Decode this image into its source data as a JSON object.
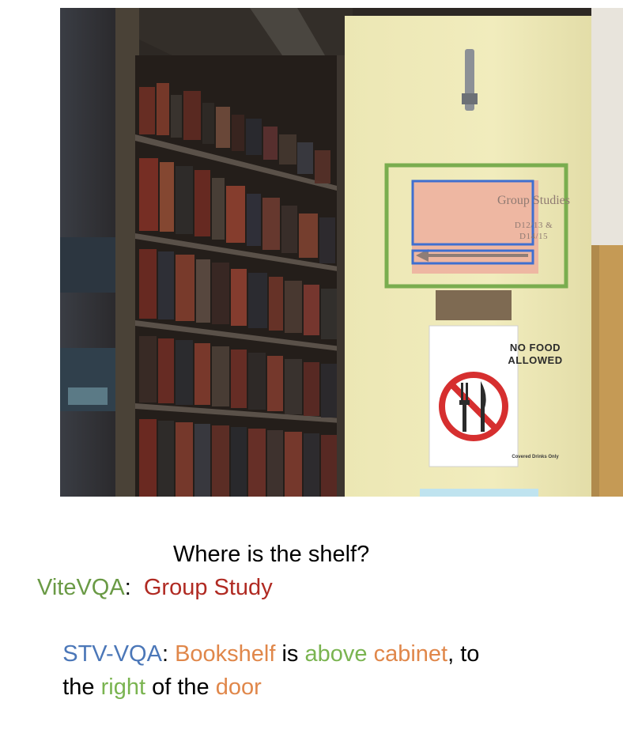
{
  "photo": {
    "group_studies_sign": {
      "title": "Group Studies",
      "rooms_line1": "D12/13 &",
      "rooms_line2": "D14/15"
    },
    "no_food_sign": {
      "line1": "NO FOOD",
      "line2": "ALLOWED",
      "footer": "Covered Drinks Only"
    }
  },
  "caption": {
    "question": "Where is the shelf?",
    "vitevqa_label": "ViteVQA",
    "vitevqa_sep": ":  ",
    "vitevqa_answer": "Group Study",
    "stvvqa_label": "STV-VQA",
    "stvvqa_sep": ": ",
    "w1": "Bookshelf",
    "w2": " is ",
    "w3": "above",
    "w4": " ",
    "w5": "cabinet",
    "w6": ", to",
    "w7": "the ",
    "w8": "right",
    "w9": " of the ",
    "w10": "door"
  },
  "colors": {
    "vitevqa": "#6a9a45",
    "vitevqa_answer": "#b02a22",
    "stvvqa": "#4b77b8",
    "object_words": "#e0874a",
    "relation_words": "#7ab450",
    "green_box": "#7aad4f",
    "blue_box": "#3f6fd0"
  }
}
